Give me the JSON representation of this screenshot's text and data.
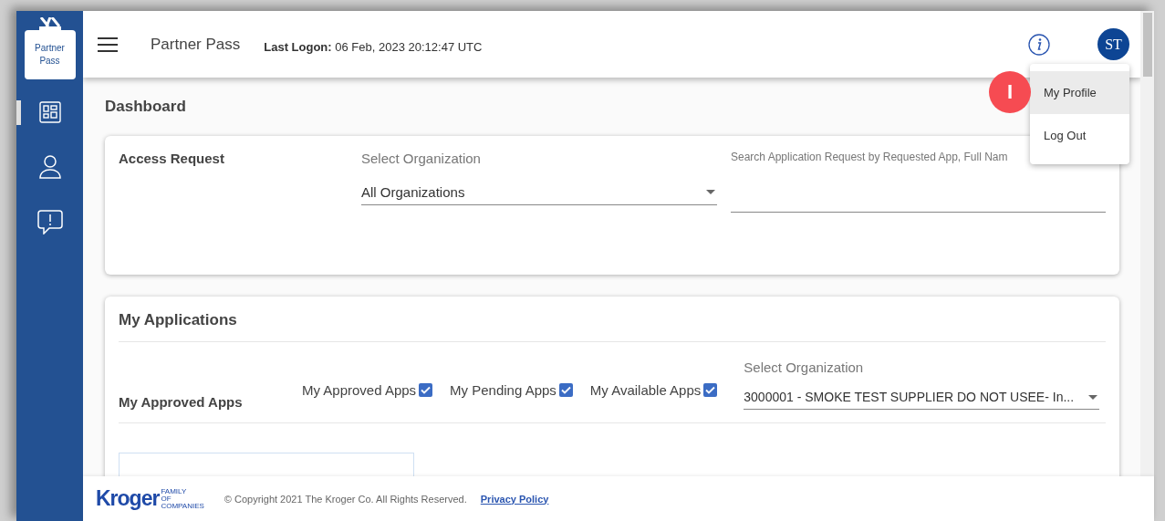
{
  "sidebar": {
    "logo": [
      "Partner",
      "Pass"
    ],
    "items": [
      {
        "kind": "grid",
        "selected": true
      },
      {
        "kind": "person",
        "selected": false
      },
      {
        "kind": "feedback",
        "selected": false
      }
    ]
  },
  "header": {
    "app_name": "Partner Pass",
    "last_logon_label": "Last Logon:",
    "last_logon_value": "06 Feb, 2023 20:12:47 UTC",
    "avatar": "ST"
  },
  "user_menu": {
    "items": [
      {
        "label": "My Profile",
        "selected": true
      },
      {
        "label": "Log Out",
        "selected": false
      }
    ]
  },
  "annotation": {
    "label": "I"
  },
  "page_title": "Dashboard",
  "access_request": {
    "title": "Access Request",
    "org_label": "Select Organization",
    "org_value": "All Organizations",
    "search_label": "Search Application Request by Requested App, Full Nam"
  },
  "my_applications": {
    "title": "My Applications",
    "subtitle": "My Approved Apps",
    "filters": [
      {
        "label": "My Approved Apps",
        "checked": true
      },
      {
        "label": "My Pending Apps",
        "checked": true
      },
      {
        "label": "My Available Apps",
        "checked": true
      }
    ],
    "org_label": "Select Organization",
    "org_value": "3000001 - SMOKE TEST SUPPLIER DO NOT USEE- In..."
  },
  "footer": {
    "brand": "Kroger",
    "brand_tag": [
      "FAMILY",
      "OF",
      "COMPANIES"
    ],
    "copyright": "© Copyright 2021 The Kroger Co. All Rights Reserved.",
    "link": "Privacy Policy"
  }
}
